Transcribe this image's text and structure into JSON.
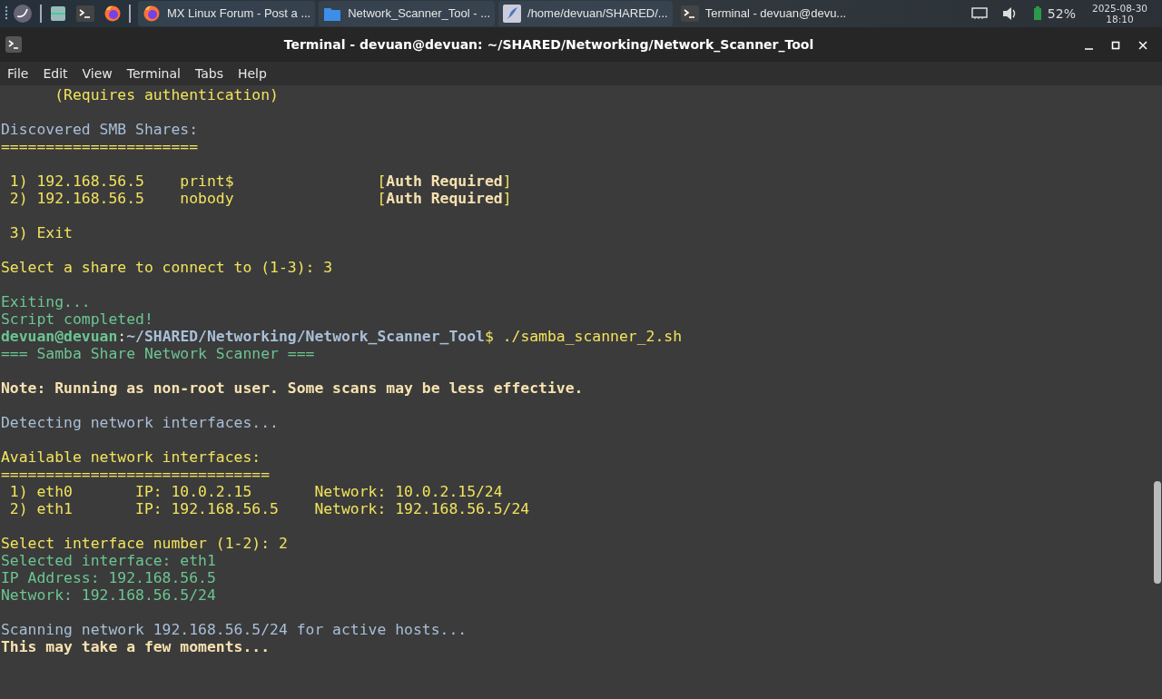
{
  "taskbar": {
    "tasks": [
      {
        "label": "MX Linux Forum - Post a ..."
      },
      {
        "label": "Network_Scanner_Tool - ..."
      },
      {
        "label": "/home/devuan/SHARED/..."
      },
      {
        "label": "Terminal - devuan@devu..."
      }
    ],
    "battery": "52%",
    "date": "2025-08-30",
    "time": "18:10"
  },
  "window": {
    "title": "Terminal - devuan@devuan: ~/SHARED/Networking/Network_Scanner_Tool"
  },
  "menu": [
    "File",
    "Edit",
    "View",
    "Terminal",
    "Tabs",
    "Help"
  ],
  "lines": [
    {
      "kind": "text",
      "segments": [
        {
          "text": "      (Requires authentication)",
          "color": "#f2e35c"
        }
      ]
    },
    {
      "kind": "blank"
    },
    {
      "kind": "text",
      "segments": [
        {
          "text": "Discovered SMB Shares:",
          "color": "#a9bfd8"
        }
      ]
    },
    {
      "kind": "text",
      "segments": [
        {
          "text": "======================",
          "color": "#f2e35c"
        }
      ]
    },
    {
      "kind": "blank"
    },
    {
      "kind": "text",
      "segments": [
        {
          "text": " 1) 192.168.56.5    print$                [",
          "color": "#f2e35c"
        },
        {
          "text": "Auth Required",
          "color": "#f7e2b0",
          "bold": true
        },
        {
          "text": "]",
          "color": "#f2e35c"
        }
      ]
    },
    {
      "kind": "text",
      "segments": [
        {
          "text": " 2) 192.168.56.5    nobody                [",
          "color": "#f2e35c"
        },
        {
          "text": "Auth Required",
          "color": "#f7e2b0",
          "bold": true
        },
        {
          "text": "]",
          "color": "#f2e35c"
        }
      ]
    },
    {
      "kind": "blank"
    },
    {
      "kind": "text",
      "segments": [
        {
          "text": " 3) Exit",
          "color": "#f2e35c"
        }
      ]
    },
    {
      "kind": "blank"
    },
    {
      "kind": "text",
      "segments": [
        {
          "text": "Select a share to connect to (1-3): 3",
          "color": "#f2e35c"
        }
      ]
    },
    {
      "kind": "blank"
    },
    {
      "kind": "text",
      "segments": [
        {
          "text": "Exiting...",
          "color": "#6cc592"
        }
      ]
    },
    {
      "kind": "text",
      "segments": [
        {
          "text": "Script completed!",
          "color": "#6cc592"
        }
      ]
    },
    {
      "kind": "text",
      "segments": [
        {
          "text": "devuan@devuan",
          "color": "#6cc592",
          "bold": true
        },
        {
          "text": ":",
          "color": "#e8e8e8"
        },
        {
          "text": "~/SHARED/Networking/Network_Scanner_Tool",
          "color": "#a9bfd8",
          "bold": true
        },
        {
          "text": "$ ./samba_scanner_2.sh",
          "color": "#f2e35c"
        }
      ]
    },
    {
      "kind": "text",
      "segments": [
        {
          "text": "=== Samba Share Network Scanner ===",
          "color": "#6cc592"
        }
      ]
    },
    {
      "kind": "blank"
    },
    {
      "kind": "text",
      "segments": [
        {
          "text": "Note: Running as non-root user. Some scans may be less effective.",
          "color": "#f7e2b0",
          "bold": true
        }
      ]
    },
    {
      "kind": "blank"
    },
    {
      "kind": "text",
      "segments": [
        {
          "text": "Detecting network interfaces...",
          "color": "#a9bfd8"
        }
      ]
    },
    {
      "kind": "blank"
    },
    {
      "kind": "text",
      "segments": [
        {
          "text": "Available network interfaces:",
          "color": "#f2e35c"
        }
      ]
    },
    {
      "kind": "text",
      "segments": [
        {
          "text": "==============================",
          "color": "#f2e35c"
        }
      ]
    },
    {
      "kind": "text",
      "segments": [
        {
          "text": " 1) eth0       IP: 10.0.2.15       Network: 10.0.2.15/24",
          "color": "#f2e35c"
        }
      ]
    },
    {
      "kind": "text",
      "segments": [
        {
          "text": " 2) eth1       IP: 192.168.56.5    Network: 192.168.56.5/24",
          "color": "#f2e35c"
        }
      ]
    },
    {
      "kind": "blank"
    },
    {
      "kind": "text",
      "segments": [
        {
          "text": "Select interface number (1-2): 2",
          "color": "#f2e35c"
        }
      ]
    },
    {
      "kind": "text",
      "segments": [
        {
          "text": "Selected interface: eth1",
          "color": "#6cc592"
        }
      ]
    },
    {
      "kind": "text",
      "segments": [
        {
          "text": "IP Address: 192.168.56.5",
          "color": "#6cc592"
        }
      ]
    },
    {
      "kind": "text",
      "segments": [
        {
          "text": "Network: 192.168.56.5/24",
          "color": "#6cc592"
        }
      ]
    },
    {
      "kind": "blank"
    },
    {
      "kind": "text",
      "segments": [
        {
          "text": "Scanning network 192.168.56.5/24 for active hosts...",
          "color": "#a9bfd8"
        }
      ]
    },
    {
      "kind": "text",
      "segments": [
        {
          "text": "This may take a few moments...",
          "color": "#f7e2b0",
          "bold": true
        }
      ]
    }
  ]
}
